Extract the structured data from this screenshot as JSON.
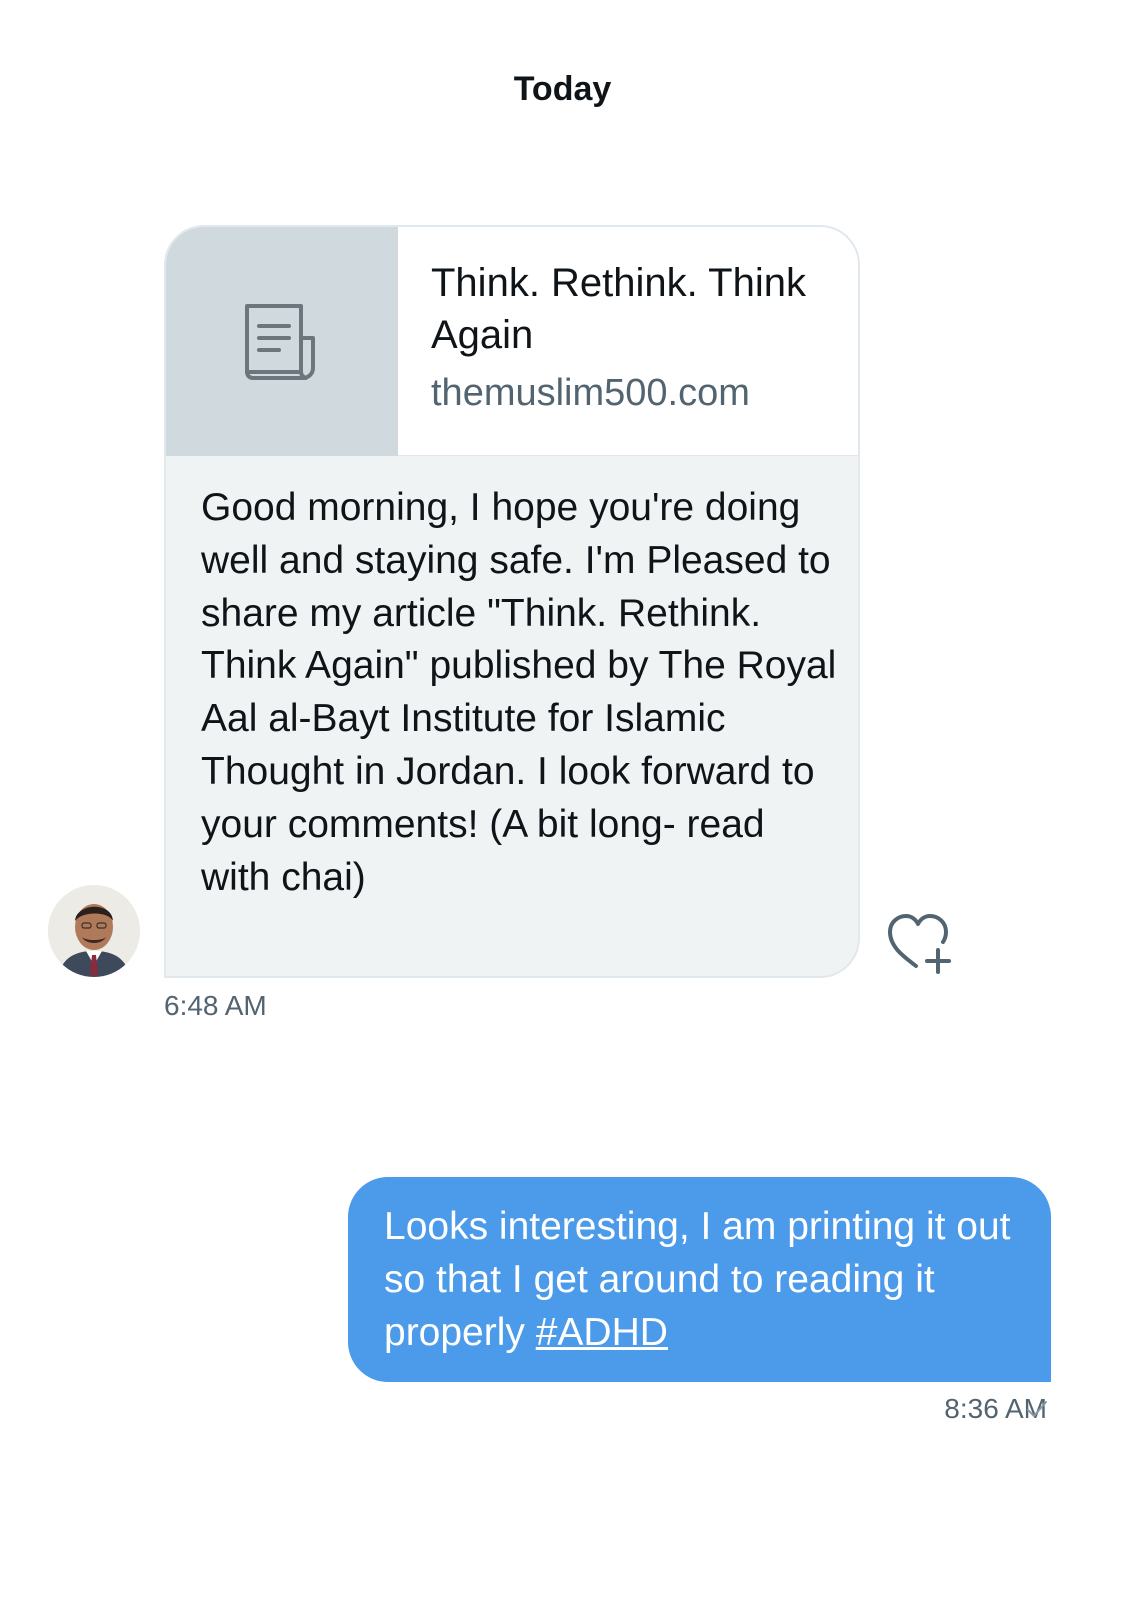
{
  "header": {
    "date_label": "Today"
  },
  "incoming_message": {
    "link_card": {
      "title": "Think. Rethink. Think Again",
      "domain": "themuslim500.com",
      "thumbnail_icon": "article-icon"
    },
    "text": "Good morning, I hope you're doing well and staying safe. I'm Pleased to share my article \"Think. Rethink. Think Again\" published by The Royal Aal al-Bayt Institute for Islamic Thought in Jordan. I look forward to your comments! (A bit long- read with chai)",
    "time": "6:48 AM",
    "react_icon": "heart-plus-icon"
  },
  "outgoing_message": {
    "text": "Looks interesting, I am printing it out so that I get around to reading it properly ",
    "hashtag": "#ADHD",
    "time": "8:36 AM",
    "status_icon": "checkmark-icon"
  },
  "colors": {
    "outgoing_bubble": "#4c9aea",
    "incoming_bubble": "#eff3f4",
    "thumbnail_bg": "#cfd9de",
    "secondary_text": "#536471"
  }
}
